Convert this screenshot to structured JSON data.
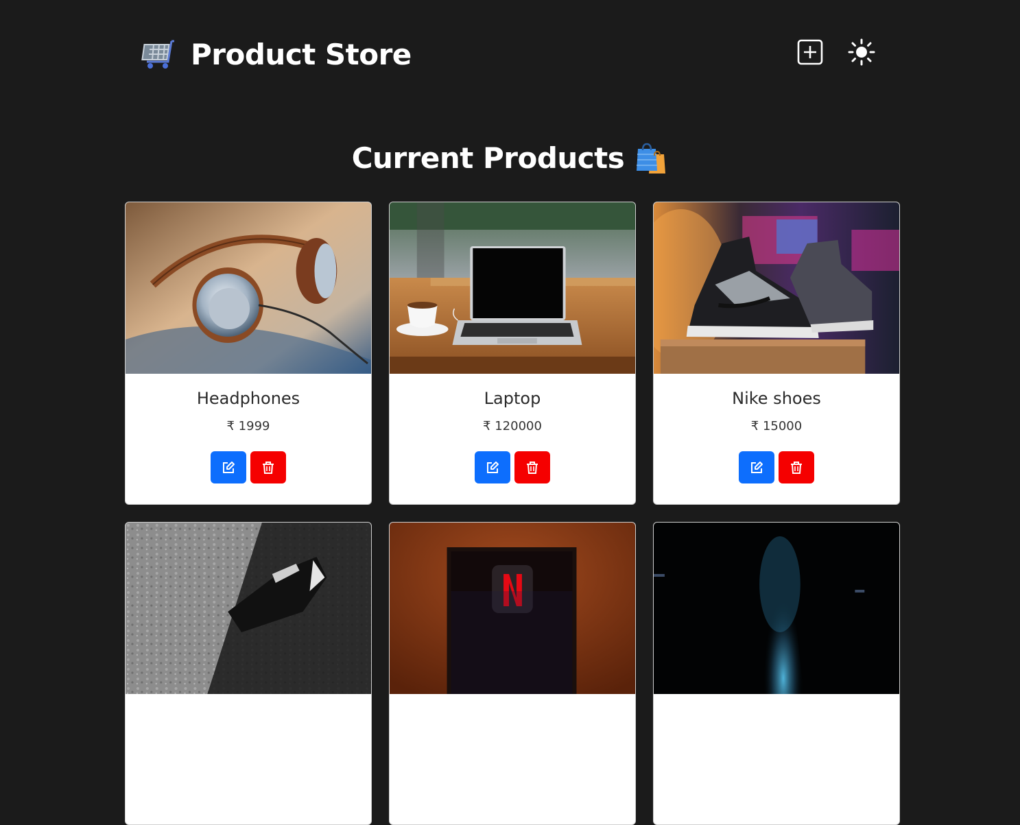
{
  "header": {
    "brand_title": "Product Store",
    "brand_icon": "shopping-cart-icon",
    "add_icon": "plus-square-icon",
    "theme_icon": "sun-icon"
  },
  "main": {
    "heading": "Current Products",
    "heading_icon": "shopping-bags-icon"
  },
  "products": [
    {
      "name": "Headphones",
      "price": "₹ 1999",
      "image": "headphones-photo"
    },
    {
      "name": "Laptop",
      "price": "₹ 120000",
      "image": "laptop-photo"
    },
    {
      "name": "Nike shoes",
      "price": "₹ 15000",
      "image": "nike-shoes-photo"
    },
    {
      "name": "",
      "price": "",
      "image": "black-sneaker-photo"
    },
    {
      "name": "",
      "price": "",
      "image": "netflix-tv-photo"
    },
    {
      "name": "",
      "price": "",
      "image": "dark-stage-photo"
    }
  ],
  "colors": {
    "background": "#1b1b1b",
    "edit_button": "#0d6efd",
    "delete_button": "#f50000",
    "card": "#ffffff"
  }
}
